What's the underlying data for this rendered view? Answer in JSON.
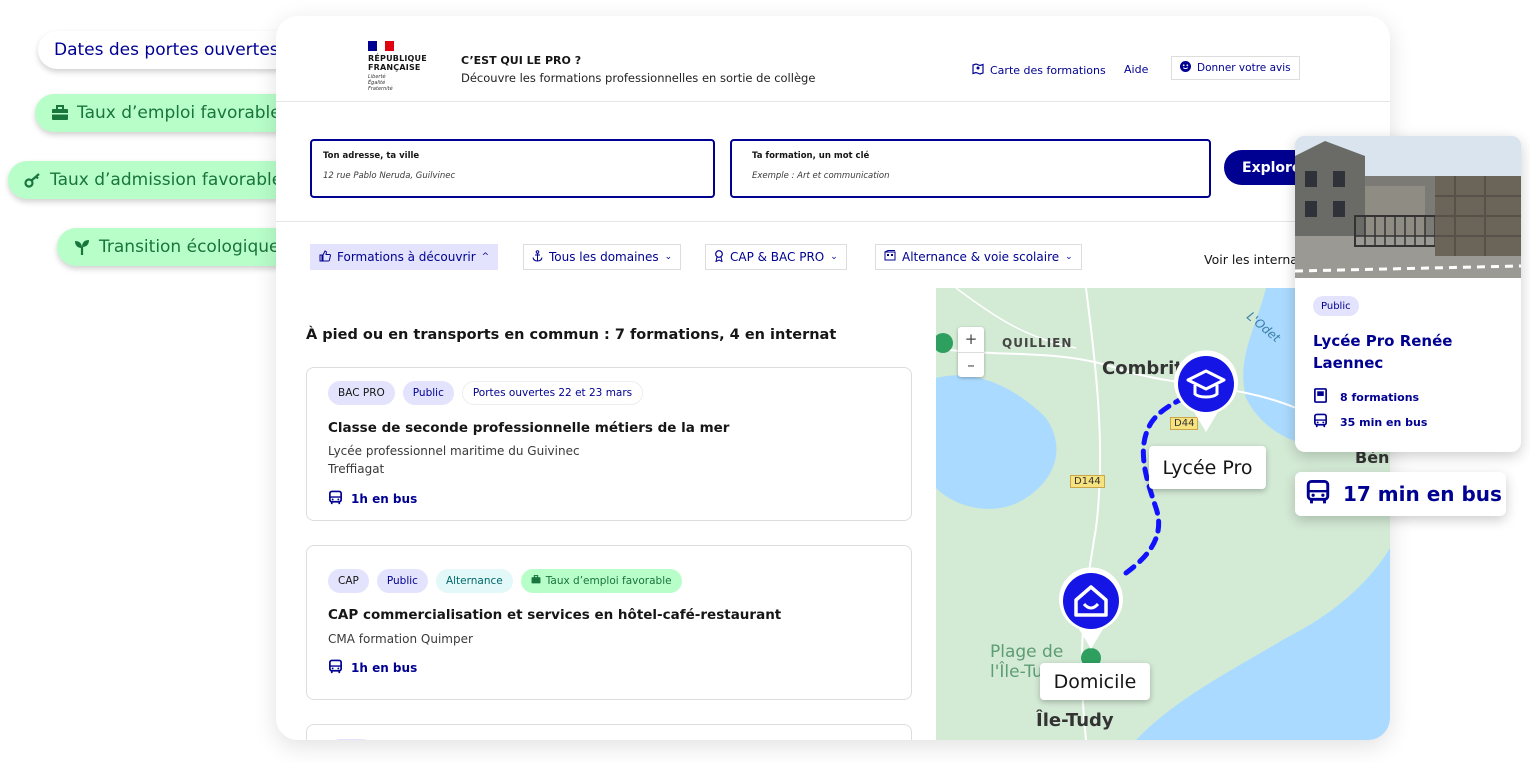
{
  "pills": {
    "portes": "Dates des portes ouvertes",
    "emploi": "Taux d’emploi favorable",
    "admission": "Taux d’admission favorable",
    "transition": "Transition écologique"
  },
  "header": {
    "republique_line1": "RÉPUBLIQUE",
    "republique_line2": "FRANÇAISE",
    "devise": [
      "Liberté",
      "Égalité",
      "Fraternité"
    ],
    "site_title": "C’EST QUI LE PRO ?",
    "site_subtitle": "Découvre les formations professionnelles en sortie de collège",
    "link_carte": "Carte des formations",
    "link_aide": "Aide",
    "link_avis": "Donner votre avis"
  },
  "search": {
    "address_label": "Ton adresse, ta ville",
    "address_value": "12 rue  Pablo Neruda, Guilvinec",
    "formation_label": "Ta formation,  un mot clé",
    "formation_placeholder": "Exemple : Art et communication",
    "explore_label": "Explorer"
  },
  "filters": {
    "formations": "Formations à découvrir",
    "domaines": "Tous les domaines",
    "diplomes": "CAP & BAC PRO",
    "voie": "Alternance & voie scolaire",
    "voir_internat": "Voir les internats"
  },
  "results": {
    "title": "À pied ou en transports en commun : 7 formations, 4 en internat",
    "cards": [
      {
        "tags": [
          "BAC PRO",
          "Public",
          "Portes ouvertes 22 et 23 mars"
        ],
        "title": "Classe de seconde professionnelle métiers de la mer",
        "etablissement": "Lycée professionnel maritime du Guivinec",
        "ville": "Treffiagat",
        "transport": "1h en bus"
      },
      {
        "tags": [
          "CAP",
          "Public",
          "Alternance",
          "Taux d’emploi favorable"
        ],
        "title": "CAP commercialisation et services en hôtel-café-restaurant",
        "etablissement": "CMA formation Quimper",
        "transport": "1h en bus"
      }
    ]
  },
  "map": {
    "zoom_in": "+",
    "zoom_out": "–",
    "places": {
      "quillien": "QUILLIEN",
      "combrit": "Combrit",
      "odet": "L'Odet",
      "benodet": "Bén",
      "plage_line1": "Plage de",
      "plage_line2": "l'Île-Tudy",
      "ile_tudy": "Île-Tudy"
    },
    "roads": [
      "D44",
      "D144"
    ],
    "callout_lycee": "Lycée Pro",
    "callout_domicile": "Domicile"
  },
  "school_popup": {
    "tag": "Public",
    "name": "Lycée Pro Renée Laennec",
    "formations": "8 formations",
    "duration": "35 min en bus"
  },
  "bus_badge": "17 min en bus",
  "colors": {
    "primary": "#000091",
    "green_bg": "#b8fec9",
    "green_text": "#18753c",
    "tag_bg": "#e3e3fd",
    "map_water": "#aadaff",
    "map_land": "#cfe8d2"
  }
}
